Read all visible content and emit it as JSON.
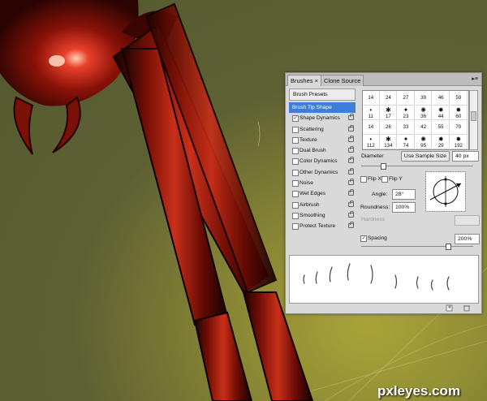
{
  "panel": {
    "tabs": [
      {
        "label": "Brushes",
        "active": true
      },
      {
        "label": "Clone Source",
        "active": false
      }
    ],
    "tab_close": "×",
    "menu_icon": "panel-menu-icon",
    "presets_label": "Brush Presets",
    "options": [
      {
        "label": "Brush Tip Shape",
        "selected": true,
        "checked": null,
        "locked": false
      },
      {
        "label": "Shape Dynamics",
        "checked": true,
        "locked": true
      },
      {
        "label": "Scattering",
        "checked": false,
        "locked": true
      },
      {
        "label": "Texture",
        "checked": false,
        "locked": true
      },
      {
        "label": "Dual Brush",
        "checked": false,
        "locked": true
      },
      {
        "label": "Color Dynamics",
        "checked": false,
        "locked": true
      },
      {
        "label": "Other Dynamics",
        "checked": false,
        "locked": true
      },
      {
        "label": "Noise",
        "checked": false,
        "locked": true
      },
      {
        "label": "Wet Edges",
        "checked": false,
        "locked": true
      },
      {
        "label": "Airbrush",
        "checked": false,
        "locked": true
      },
      {
        "label": "Smoothing",
        "checked": false,
        "locked": true
      },
      {
        "label": "Protect Texture",
        "checked": false,
        "locked": true
      }
    ],
    "brush_sizes": [
      [
        "14",
        "24",
        "27",
        "39",
        "46",
        "59"
      ],
      [
        "11",
        "17",
        "23",
        "36",
        "44",
        "60"
      ],
      [
        "14",
        "26",
        "33",
        "42",
        "55",
        "70"
      ],
      [
        "112",
        "134",
        "74",
        "95",
        "29",
        "192"
      ]
    ],
    "diameter": {
      "label": "Diameter",
      "button": "Use Sample Size",
      "value": "40 px"
    },
    "flip_x": {
      "label": "Flip X",
      "checked": false
    },
    "flip_y": {
      "label": "Flip Y",
      "checked": false
    },
    "angle": {
      "label": "Angle:",
      "value": "28°"
    },
    "roundness": {
      "label": "Roundness:",
      "value": "100%"
    },
    "hardness": {
      "label": "Hardness"
    },
    "spacing": {
      "label": "Spacing",
      "checked": true,
      "value": "200%"
    }
  },
  "watermark": "pxleyes.com",
  "colors": {
    "background": "#5e6133",
    "selected": "#3d7fd8",
    "panel": "#d9d9d9",
    "leg": "#b0180c"
  }
}
